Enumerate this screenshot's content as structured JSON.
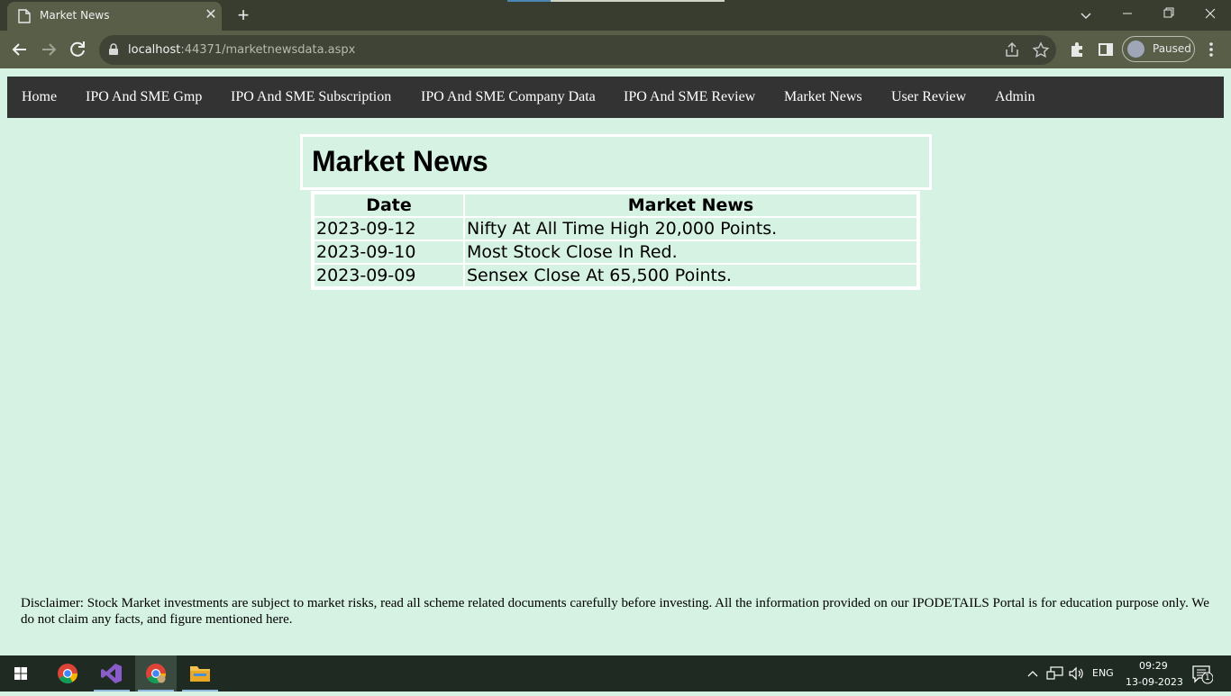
{
  "browser": {
    "tab_title": "Market News",
    "url_host": "localhost",
    "url_path": ":44371/marketnewsdata.aspx",
    "profile_label": "Paused"
  },
  "site_nav": {
    "items": [
      "Home",
      "IPO And SME Gmp",
      "IPO And SME Subscription",
      "IPO And SME Company Data",
      "IPO And SME Review",
      "Market News",
      "User Review",
      "Admin"
    ]
  },
  "main": {
    "heading": "Market News",
    "table": {
      "headers": [
        "Date",
        "Market News"
      ],
      "rows": [
        [
          "2023-09-12",
          "Nifty At All Time High 20,000 Points."
        ],
        [
          "2023-09-10",
          "Most Stock Close In Red."
        ],
        [
          "2023-09-09",
          "Sensex Close At 65,500 Points."
        ]
      ]
    }
  },
  "footer": {
    "disclaimer": "Disclaimer: Stock Market investments are subject to market risks, read all scheme related documents carefully before investing. All the information provided on our IPODETAILS Portal is for education purpose only. We do not claim any facts, and figure mentioned here."
  },
  "taskbar": {
    "language": "ENG",
    "time": "09:29",
    "date": "13-09-2023",
    "notification_count": "1"
  },
  "colors": {
    "page_bg": "#d5f2e3",
    "nav_bg": "#333333",
    "chrome_bg": "#585e48"
  }
}
